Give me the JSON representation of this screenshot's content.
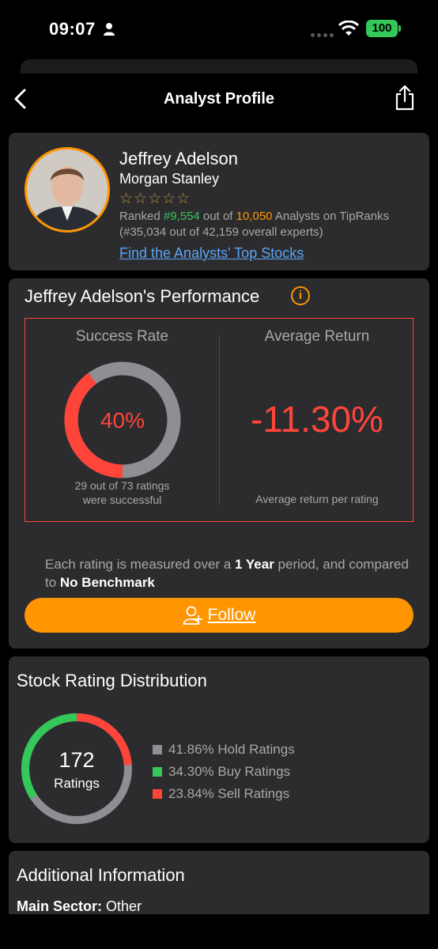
{
  "status": {
    "time": "09:07",
    "battery": "100"
  },
  "nav": {
    "title": "Analyst Profile"
  },
  "profile": {
    "name": "Jeffrey Adelson",
    "firm": "Morgan Stanley",
    "stars": "☆☆☆☆☆",
    "rank_prefix": "Ranked ",
    "rank": "#9,554",
    "rank_mid": " out of ",
    "total": "10,050",
    "rank_suffix": " Analysts on TipRanks (#35,034 out of 42,159 overall experts)",
    "link": "Find the Analysts' Top Stocks"
  },
  "performance": {
    "title": "Jeffrey Adelson's Performance",
    "info_glyph": "i",
    "success_title": "Success Rate",
    "success_value": "40%",
    "success_fraction": 0.4,
    "success_sub_1": "29 out of 73 ratings",
    "success_sub_2": "were successful",
    "avg_title": "Average Return",
    "avg_value": "-11.30%",
    "avg_sub": "Average return per rating",
    "measure_1": "Each rating is measured over a ",
    "measure_period": "1 Year",
    "measure_2": " period, and compared to ",
    "measure_bench": "No Benchmark",
    "follow": "Follow"
  },
  "distribution": {
    "title": "Stock Rating Distribution",
    "total": "172",
    "total_label": "Ratings",
    "legend": [
      {
        "label": "41.86% Hold Ratings",
        "color": "#8e8e93"
      },
      {
        "label": "34.30% Buy Ratings",
        "color": "#34c759"
      },
      {
        "label": "23.84% Sell Ratings",
        "color": "#ff453a"
      }
    ]
  },
  "additional": {
    "title": "Additional Information",
    "sector_label": "Main Sector:",
    "sector_value": "Other"
  },
  "colors": {
    "accent": "#ff9500",
    "positive": "#34c759",
    "negative": "#ff453a",
    "card": "#2c2c2e"
  }
}
